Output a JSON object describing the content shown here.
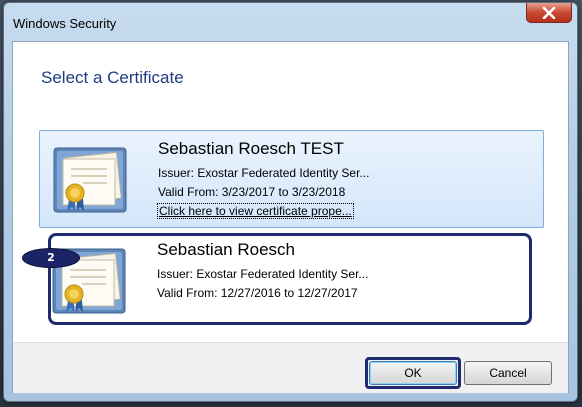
{
  "window": {
    "title": "Windows Security",
    "close_label": "X"
  },
  "dialog": {
    "heading": "Select a Certificate"
  },
  "certificates": [
    {
      "name": "Sebastian Roesch TEST",
      "issuer": "Issuer: Exostar Federated Identity Ser...",
      "valid": "Valid From: 3/23/2017 to 3/23/2018",
      "link": "Click here to view certificate prope...",
      "state": "selected"
    },
    {
      "name": "Sebastian Roesch",
      "issuer": "Issuer: Exostar Federated Identity Ser...",
      "valid": "Valid From: 12/27/2016 to 12/27/2017",
      "state": "highlighted"
    }
  ],
  "annotation": {
    "step_number": "2",
    "color": "#1f2a6e"
  },
  "buttons": {
    "ok": "OK",
    "cancel": "Cancel"
  },
  "colors": {
    "heading": "#1e3c80",
    "selection_bg": "#d4e6fb",
    "close_button": "#c94a33"
  }
}
